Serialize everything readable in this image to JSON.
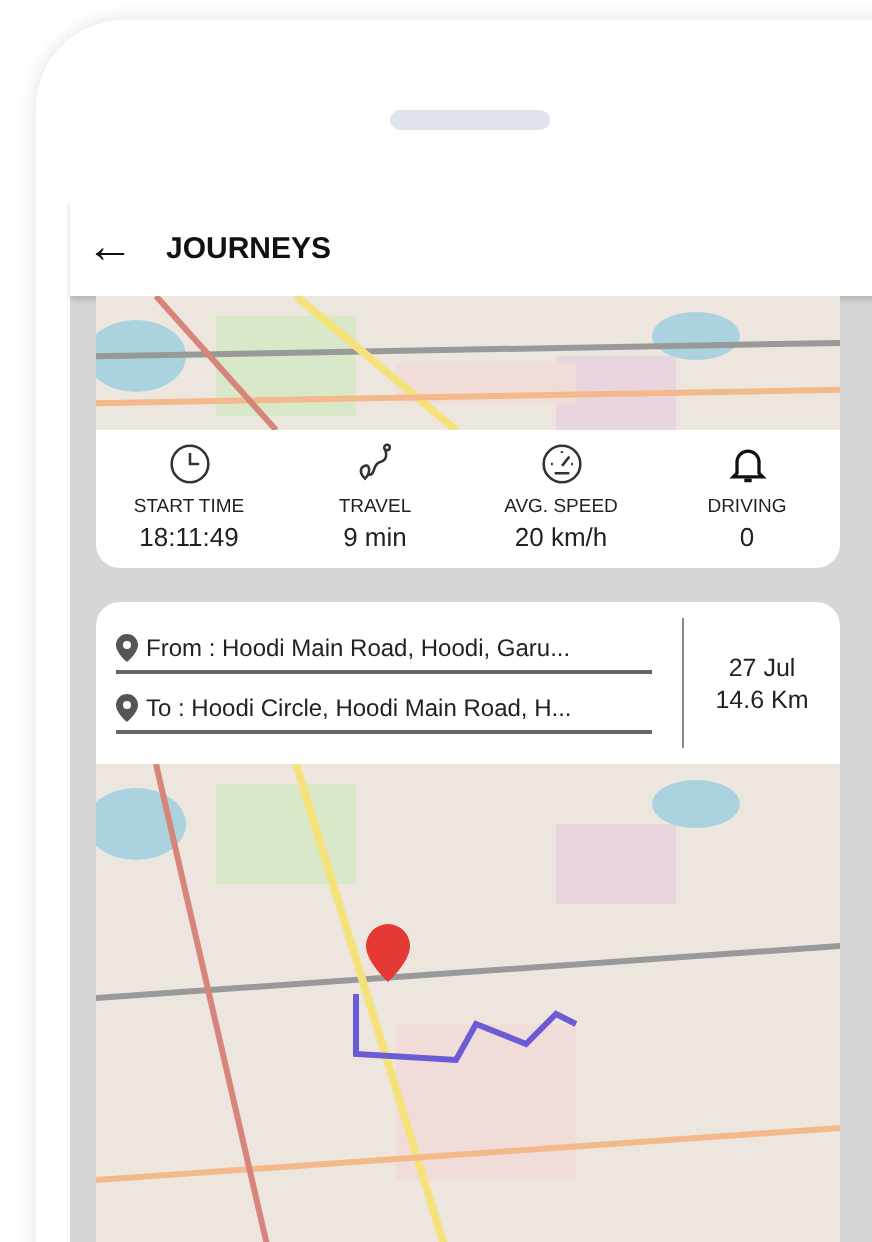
{
  "header": {
    "back": "←",
    "title": "JOURNEYS"
  },
  "summary": {
    "stats": [
      {
        "kind": "clock",
        "label": "START TIME",
        "value": "18:11:49"
      },
      {
        "kind": "route",
        "label": "TRAVEL",
        "value": "9 min"
      },
      {
        "kind": "gauge",
        "label": "AVG. SPEED",
        "value": "20 km/h"
      },
      {
        "kind": "bell",
        "label": "DRIVING",
        "value": "0"
      }
    ]
  },
  "journey": {
    "from": "From : Hoodi Main Road, Hoodi, Garu...",
    "to": "To : Hoodi Circle, Hoodi Main Road, H...",
    "date": "27 Jul",
    "distance": "14.6 Km"
  }
}
